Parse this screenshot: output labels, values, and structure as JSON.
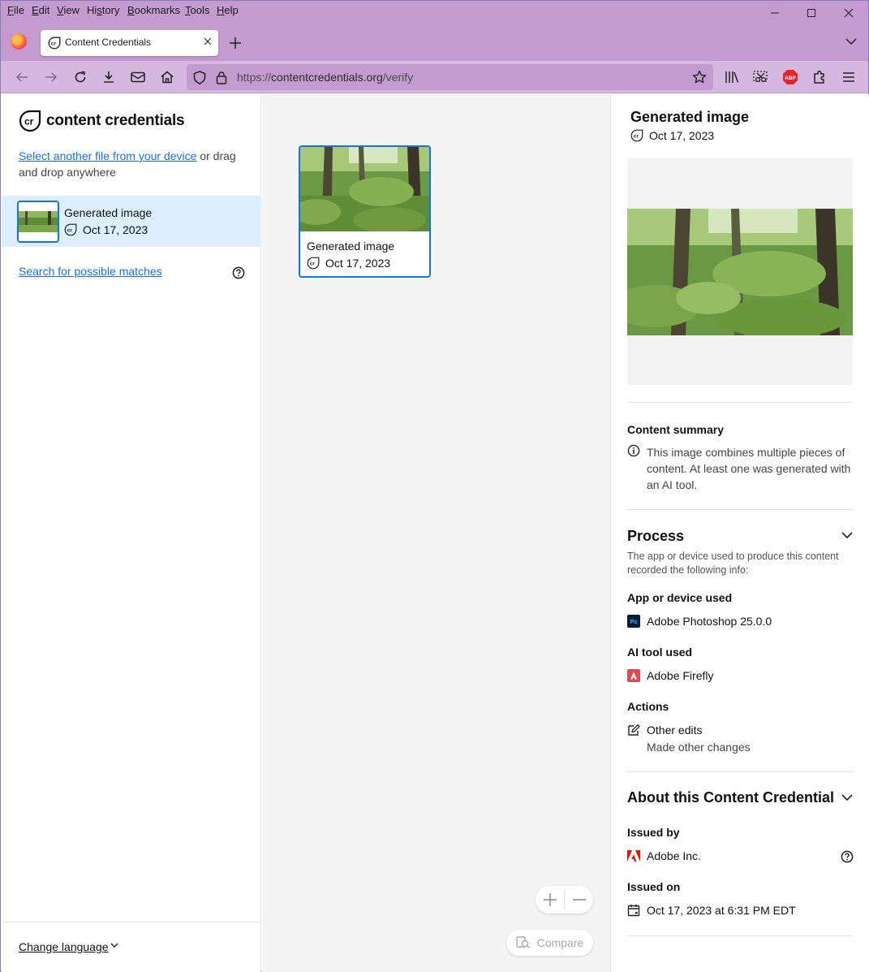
{
  "menubar": {
    "items": [
      "File",
      "Edit",
      "View",
      "History",
      "Bookmarks",
      "Tools",
      "Help"
    ],
    "access_keys": [
      "F",
      "E",
      "V",
      "s",
      "B",
      "T",
      "H"
    ]
  },
  "tab": {
    "title": "Content Credentials"
  },
  "url": {
    "prefix": "https://",
    "host": "contentcredentials.org",
    "path": "/verify"
  },
  "left": {
    "brand": "content credentials",
    "select_link": "Select another file from your device",
    "select_rest": " or drag and drop anywhere",
    "file": {
      "title": "Generated image",
      "date": "Oct 17, 2023"
    },
    "search_link": "Search for possible matches",
    "change_language": "Change language"
  },
  "center": {
    "card": {
      "title": "Generated image",
      "date": "Oct 17, 2023"
    },
    "compare_label": "Compare"
  },
  "right": {
    "title": "Generated image",
    "date": "Oct 17, 2023",
    "summary_heading": "Content summary",
    "summary_text": "This image combines multiple pieces of content. At least one was generated with an AI tool.",
    "process_heading": "Process",
    "process_desc": "The app or device used to produce this content recorded the following info:",
    "app_heading": "App or device used",
    "app_value": "Adobe Photoshop 25.0.0",
    "ai_heading": "AI tool used",
    "ai_value": "Adobe Firefly",
    "actions_heading": "Actions",
    "action_title": "Other edits",
    "action_desc": "Made other changes",
    "about_heading": "About this Content Credential",
    "issued_by_heading": "Issued by",
    "issued_by_value": "Adobe Inc.",
    "issued_on_heading": "Issued on",
    "issued_on_value": "Oct 17, 2023 at 6:31 PM EDT"
  },
  "icons": {
    "photoshop_badge": "Ps",
    "adblock_badge": "ABP"
  },
  "colors": {
    "accent": "#1473e6",
    "chrome": "#c49bd1",
    "selected_row": "#ddeeff",
    "photoshop": "#001e36",
    "firefly": "#e34850",
    "adobe_red": "#eb1000"
  }
}
